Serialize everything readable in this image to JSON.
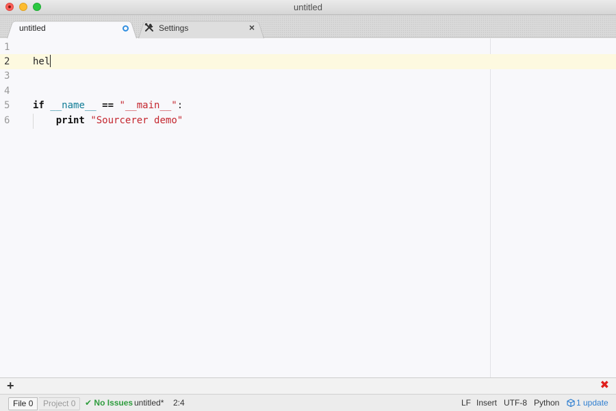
{
  "window": {
    "title": "untitled"
  },
  "tabs": [
    {
      "label": "untitled",
      "modified": true,
      "active": true
    },
    {
      "label": "Settings",
      "icon": "tools-icon",
      "close": "×",
      "active": false
    }
  ],
  "editor": {
    "line_numbers": [
      "1",
      "2",
      "3",
      "4",
      "5",
      "6"
    ],
    "current_line": 2,
    "lines": {
      "l2": "hel",
      "l5_kw": "if",
      "l5_name": "__name__",
      "l5_op": " == ",
      "l5_str": "\"__main__\"",
      "l5_colon": ":",
      "l6_kw": "print",
      "l6_str": "\"Sourcerer demo\""
    }
  },
  "panel": {
    "add_symbol": "+",
    "close_symbol": "✖"
  },
  "status": {
    "file_label": "File",
    "file_count": "0",
    "project_label": "Project",
    "project_count": "0",
    "issues_icon": "✔",
    "issues": "No Issues",
    "filename": "untitled*",
    "cursor_pos": "2:4",
    "line_ending": "LF",
    "mode": "Insert",
    "encoding": "UTF-8",
    "grammar": "Python",
    "updates": "1 update"
  },
  "colors": {
    "accent": "#2f8ee0",
    "keyword": "#111111",
    "dunder": "#0f7c96",
    "string": "#c4262e",
    "current_line": "#fdf9e0",
    "ok": "#2e9c3d",
    "error": "#e0201d"
  }
}
